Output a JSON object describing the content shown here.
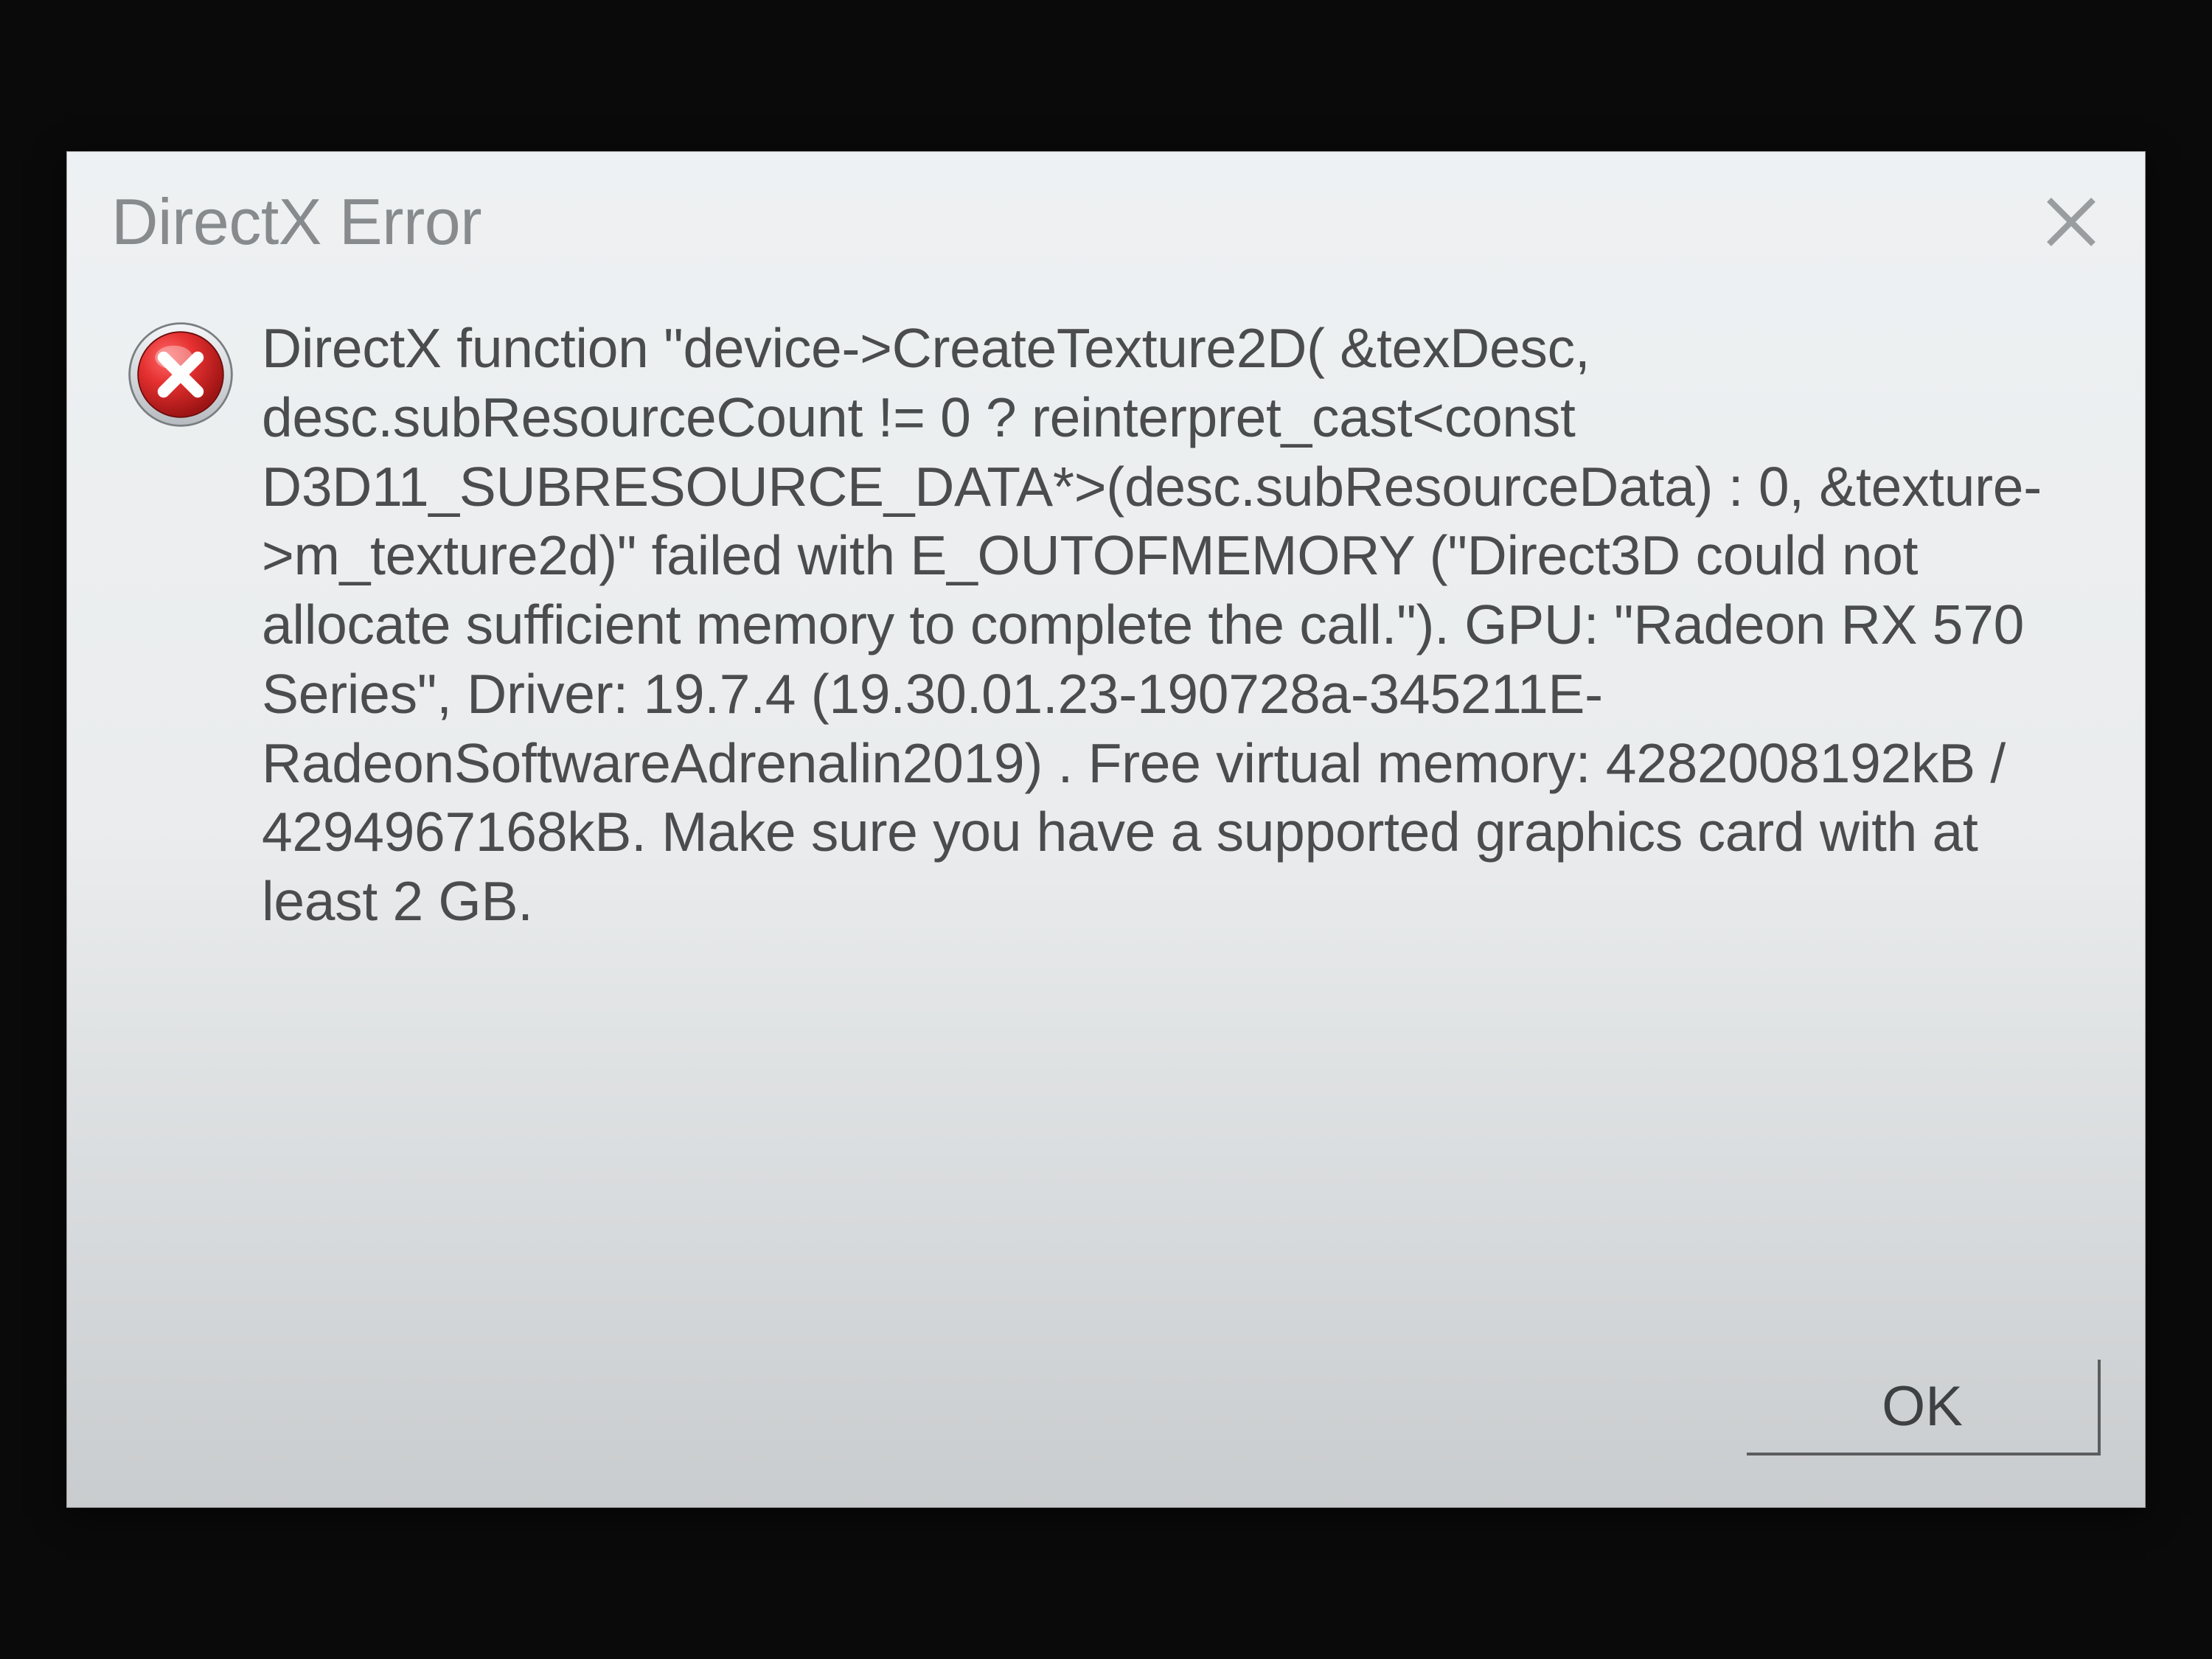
{
  "dialog": {
    "title": "DirectX Error",
    "message": "DirectX function \"device->CreateTexture2D( &texDesc, desc.subResourceCount != 0 ? reinterpret_cast<const D3D11_SUBRESOURCE_DATA*>(desc.subResourceData) : 0, &texture->m_texture2d)\" failed with E_OUTOFMEMORY (\"Direct3D could not allocate sufficient memory to complete the call.\"). GPU: \"Radeon RX 570 Series\", Driver: 19.7.4 (19.30.01.23-190728a-345211E-RadeonSoftwareAdrenalin2019) . Free virtual memory: 4282008192kB / 4294967168kB. Make sure you have a supported graphics card with at least 2 GB.",
    "buttons": {
      "ok": "OK"
    }
  }
}
